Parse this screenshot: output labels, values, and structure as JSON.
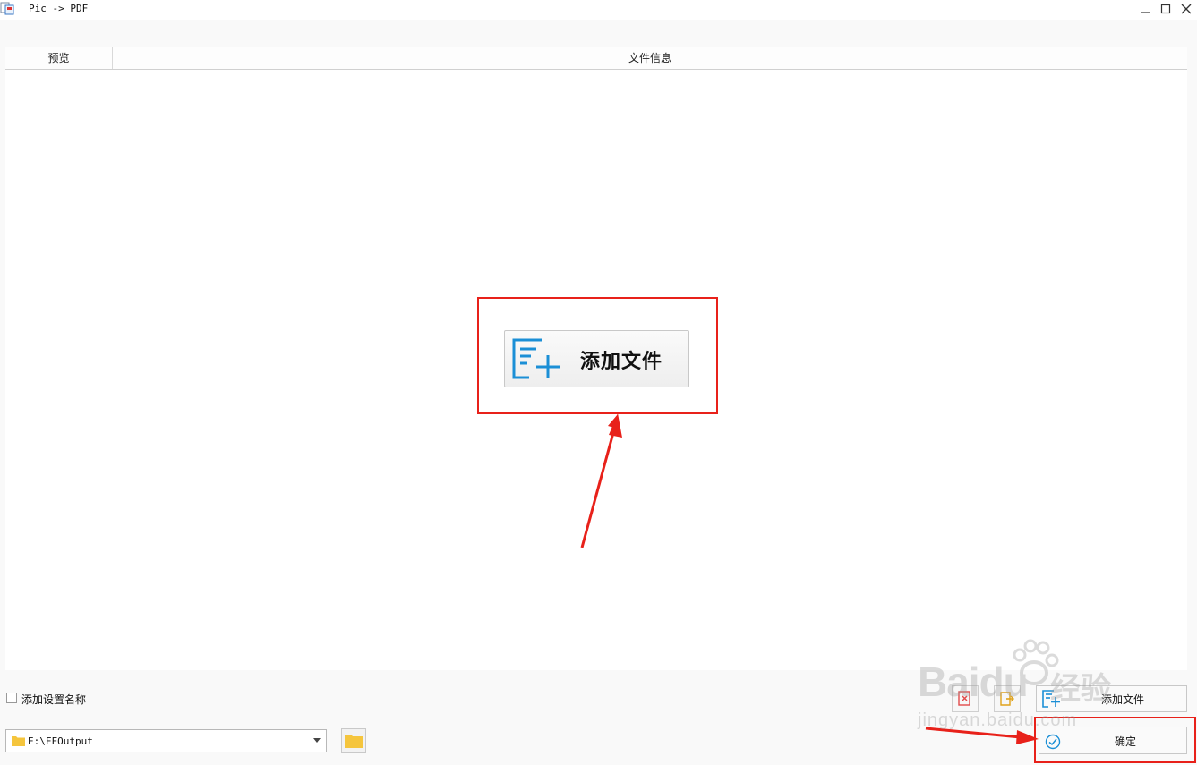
{
  "window": {
    "title": "Pic -> PDF",
    "controls": [
      "minimize-icon",
      "maximize-icon",
      "close-icon"
    ]
  },
  "table": {
    "columns": [
      "预览",
      "文件信息"
    ]
  },
  "center_add": {
    "label": "添加文件",
    "icon": "add-file-icon"
  },
  "bottom": {
    "checkbox_label": "添加设置名称",
    "checkbox_checked": false,
    "output_path": "E:\\FFOutput",
    "folder_icon": "folder-icon",
    "browse_icon": "folder-icon",
    "remove_icon": "remove-file-icon",
    "clear_icon": "clear-list-icon",
    "add_file_label": "添加文件",
    "ok_label": "确定"
  },
  "watermark": {
    "logo": "Baidu",
    "logo_cn": "经验",
    "url": "jingyan.baidu.com"
  },
  "colors": {
    "accent_blue": "#1b8fd6",
    "annotation_red": "#e8211a",
    "folder_yellow": "#f5c53d"
  }
}
